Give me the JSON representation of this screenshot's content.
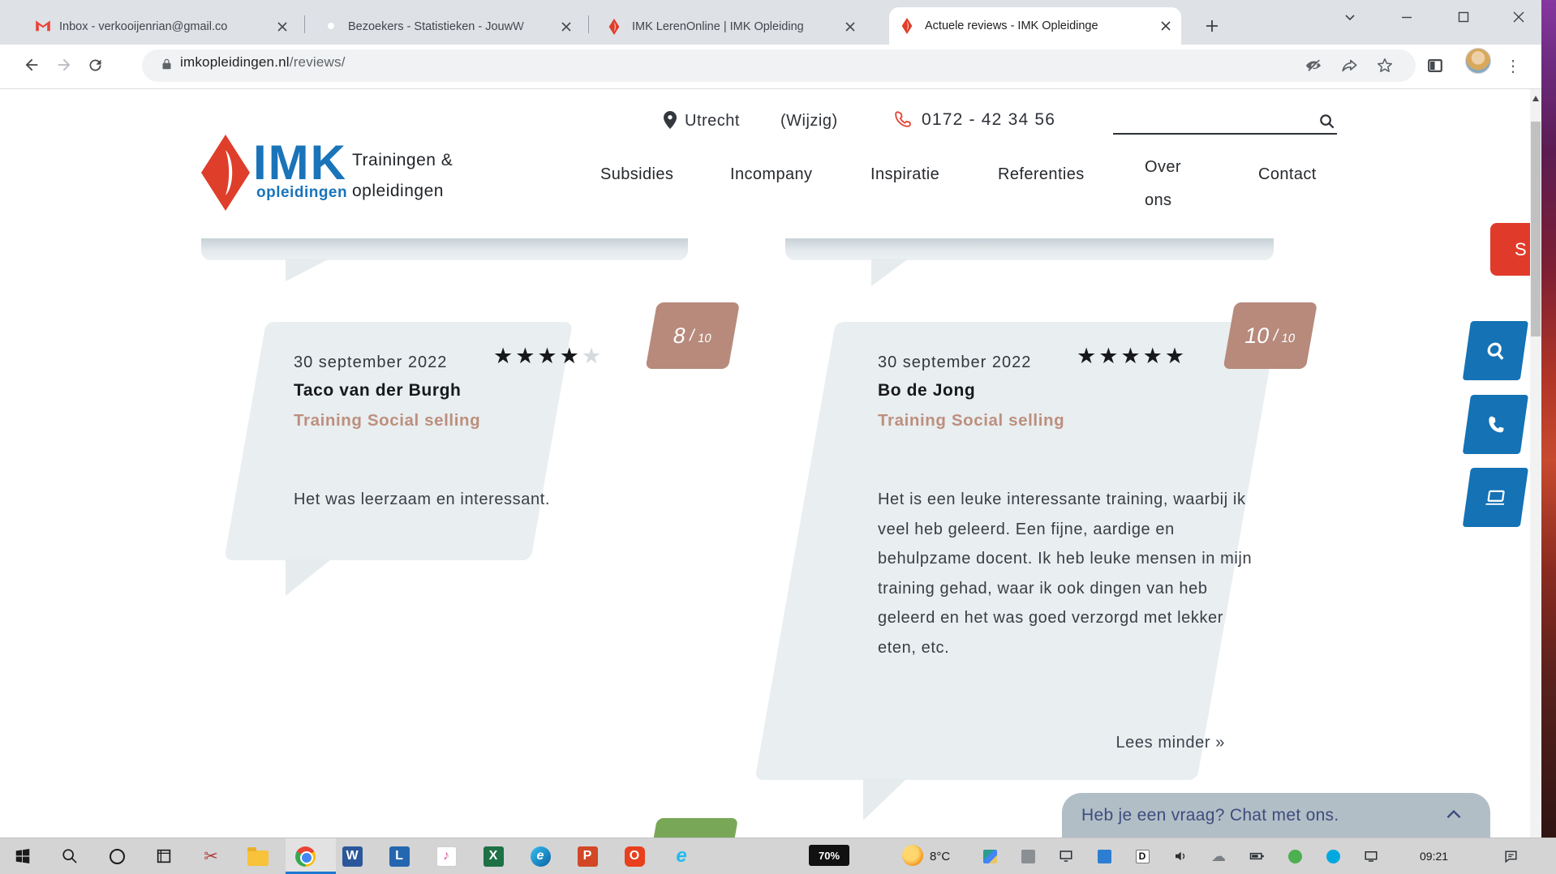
{
  "browser": {
    "tabs": [
      {
        "title": "Inbox - verkooijenrian@gmail.co"
      },
      {
        "title": "Bezoekers - Statistieken - JouwW"
      },
      {
        "title": "IMK LerenOnline | IMK Opleiding"
      },
      {
        "title": "Actuele reviews - IMK Opleidinge"
      }
    ],
    "url_domain": "imkopleidingen.nl",
    "url_path": "/reviews/"
  },
  "site_header": {
    "logo_main": "IMK",
    "logo_tagline_top": "Trainingen &",
    "logo_tagline_blue": "opleidingen",
    "logo_tagline_bottom": "opleidingen",
    "location_city": "Utrecht",
    "location_change_label": "(Wijzig)",
    "phone_number": "0172 - 42 34 56",
    "nav": [
      "Subsidies",
      "Incompany",
      "Inspiratie",
      "Referenties",
      "Over ons",
      "Contact"
    ]
  },
  "reviews": [
    {
      "date": "30 september 2022",
      "stars_filled": "★★★★",
      "stars_empty": "★",
      "name": "Taco van der Burgh",
      "training": "Training Social selling",
      "score": "8",
      "score_separator": "/",
      "score_max": "10",
      "text": "Het was leerzaam en interessant."
    },
    {
      "date": "30 september 2022",
      "stars_filled": "★★★★★",
      "stars_empty": "",
      "name": "Bo de Jong",
      "training": "Training Social selling",
      "score": "10",
      "score_separator": "/",
      "score_max": "10",
      "text": "Het is een leuke interessante training, waarbij ik veel heb geleerd. Een fijne, aardige en behulpzame docent. Ik heb leuke mensen in mijn training gehad, waar ik ook dingen van heb geleerd en het was goed verzorgd met lekker eten, etc.",
      "read_less_label": "Lees minder »"
    }
  ],
  "floating": {
    "side_tab_label": "S"
  },
  "chat": {
    "message": "Heb je een vraag? Chat met ons."
  },
  "taskbar": {
    "battery_level": "70%",
    "temperature": "8°C",
    "time": "09:21"
  },
  "colors": {
    "brand_blue": "#1a74b9",
    "brand_red": "#df3e2b",
    "badge_rose": "#b78a7c",
    "badge_green": "#79a758",
    "card_background": "#e9eef0",
    "action_blue": "#1472b5",
    "chat_background": "#b2bec6",
    "chat_text": "#3e4c7e"
  }
}
